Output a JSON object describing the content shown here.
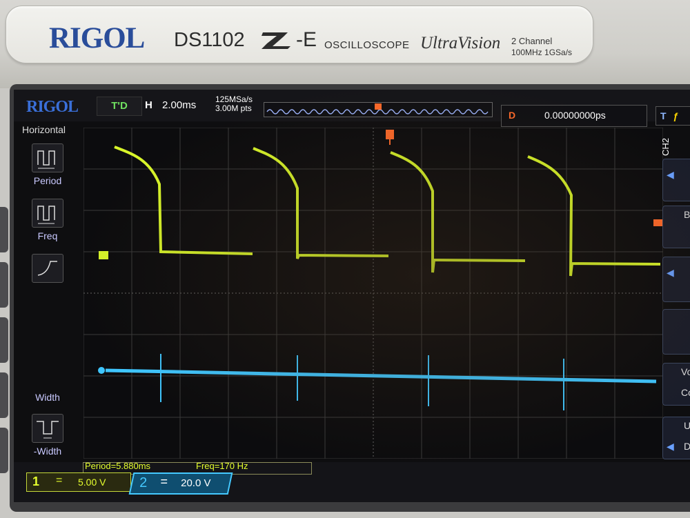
{
  "panel": {
    "brand": "RIGOL",
    "model": "DS1102",
    "series_suffix": "-E",
    "product_name": "OSCILLOSCOPE",
    "ultravision": "UltraVision",
    "spec_channels": "2 Channel",
    "spec_bandwidth": "100MHz  1GSa/s"
  },
  "screen": {
    "logo": "RIGOL",
    "run_state": "T'D",
    "horizontal_letter": "H",
    "time_base": "2.00ms",
    "sample_rate": "125MSa/s",
    "memory_depth": "3.00M pts",
    "trigger_letter": "D",
    "trigger_delay": "0.00000000ps",
    "trigger_type": "T",
    "ch2_side_label": "CH2"
  },
  "left_menu": {
    "title": "Horizontal",
    "items": [
      {
        "label": "Period",
        "icon": "period-icon"
      },
      {
        "label": "Freq",
        "icon": "frequency-icon"
      },
      {
        "label": "",
        "icon": "rise-time-icon"
      },
      {
        "label": "-Width",
        "icon": "negative-width-icon"
      }
    ],
    "partial_item_label": "Width"
  },
  "measurements": {
    "period": "Period=5.880ms",
    "freq": "Freq=170 Hz"
  },
  "channels": {
    "ch1": {
      "number": "1",
      "coupling": "=",
      "scale": "5.00 V",
      "color": "#e6ff2e"
    },
    "ch2": {
      "number": "2",
      "coupling": "=",
      "scale": "20.0 V",
      "color": "#45c9ff"
    }
  },
  "right_menu": {
    "item_labels": [
      "B",
      "Vo",
      "Co",
      "U",
      "D"
    ]
  }
}
